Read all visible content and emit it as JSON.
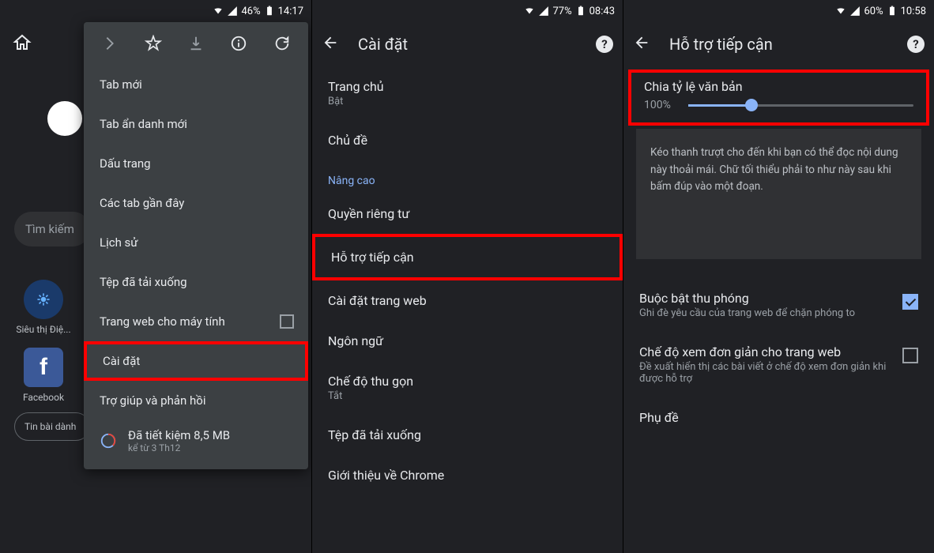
{
  "screen1": {
    "status": {
      "battery": "46%",
      "time": "14:17"
    },
    "search_placeholder": "Tìm kiếm",
    "shortcuts": [
      {
        "label": "Siêu thị Điệ..."
      },
      {
        "label": "Facebook"
      }
    ],
    "news_chip": "Tin bài dành",
    "menu": {
      "items": [
        "Tab mới",
        "Tab ẩn danh mới",
        "Dấu trang",
        "Các tab gần đây",
        "Lịch sử",
        "Tệp đã tải xuống",
        "Trang web cho máy tính",
        "Cài đặt",
        "Trợ giúp và phản hồi"
      ],
      "highlight_index": 7,
      "data_saved_line1": "Đã tiết kiệm 8,5 MB",
      "data_saved_line2": "kể từ 3 Th12"
    }
  },
  "screen2": {
    "status": {
      "battery": "77%",
      "time": "08:43"
    },
    "title": "Cài đặt",
    "items": [
      {
        "title": "Trang chủ",
        "sub": "Bật"
      },
      {
        "title": "Chủ đề"
      }
    ],
    "section": "Nâng cao",
    "advanced": [
      {
        "title": "Quyền riêng tư"
      },
      {
        "title": "Hỗ trợ tiếp cận",
        "highlight": true
      },
      {
        "title": "Cài đặt trang web"
      },
      {
        "title": "Ngôn ngữ"
      },
      {
        "title": "Chế độ thu gọn",
        "sub": "Tắt"
      },
      {
        "title": "Tệp đã tải xuống"
      },
      {
        "title": "Giới thiệu về Chrome"
      }
    ]
  },
  "screen3": {
    "status": {
      "battery": "60%",
      "time": "10:58"
    },
    "title": "Hỗ trợ tiếp cận",
    "slider": {
      "title": "Chia tỷ lệ văn bản",
      "value": "100%"
    },
    "info_text": "Kéo thanh trượt cho đến khi bạn có thể đọc nội dung này thoải mái. Chữ tối thiểu phải to như này sau khi bấm đúp vào một đoạn.",
    "options": [
      {
        "title": "Buộc bật thu phóng",
        "sub": "Ghi đè yêu cầu của trang web để chặn phóng to",
        "checked": true
      },
      {
        "title": "Chế độ xem đơn giản cho trang web",
        "sub": "Đề xuất hiển thị các bài viết ở chế độ xem đơn giản khi được hỗ trợ",
        "checked": false
      },
      {
        "title": "Phụ đề"
      }
    ]
  }
}
